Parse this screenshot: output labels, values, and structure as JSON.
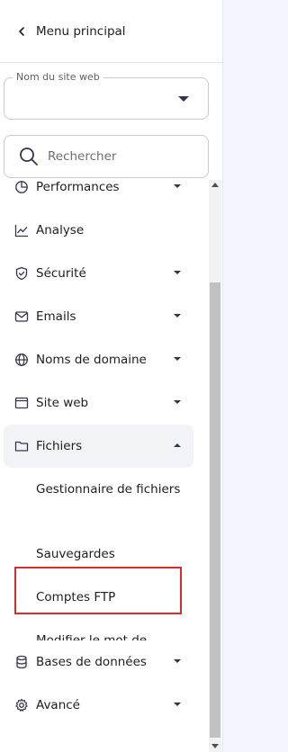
{
  "header": {
    "back_label": "Menu principal"
  },
  "site_select": {
    "legend": "Nom du site web",
    "value": ""
  },
  "search": {
    "placeholder": "Rechercher"
  },
  "nav": {
    "items": [
      {
        "label": "Performances",
        "icon": "gauge-icon"
      },
      {
        "label": "Analyse",
        "icon": "chart-line-icon"
      },
      {
        "label": "Sécurité",
        "icon": "shield-icon"
      },
      {
        "label": "Emails",
        "icon": "envelope-icon"
      },
      {
        "label": "Noms de domaine",
        "icon": "globe-icon"
      },
      {
        "label": "Site web",
        "icon": "browser-window-icon"
      },
      {
        "label": "Fichiers",
        "icon": "folder-icon"
      },
      {
        "label": "Bases de données",
        "icon": "database-icon"
      },
      {
        "label": "Avancé",
        "icon": "gear-icon"
      }
    ],
    "files_sub": [
      "Gestionnaire de fichiers",
      "Sauvegardes",
      "Comptes FTP",
      "Modifier le mot de"
    ]
  },
  "colors": {
    "highlight": "#d92d2d",
    "active_bg": "#f2f3f6",
    "page_bg": "#f4f5ff"
  }
}
